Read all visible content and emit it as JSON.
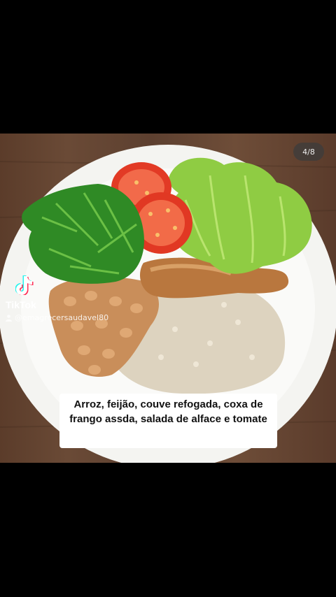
{
  "pager": {
    "text": "4/8"
  },
  "watermark": {
    "brand": "TikTok",
    "handle": "@emagrecersaudavel80"
  },
  "caption": {
    "text": "Arroz, feijão, couve refogada, coxa de frango assda, salada de alface e tomate"
  },
  "colors": {
    "background": "#000000",
    "table": "#5d4030",
    "plate": "#f4f4f2",
    "caption_bg": "#ffffff"
  }
}
